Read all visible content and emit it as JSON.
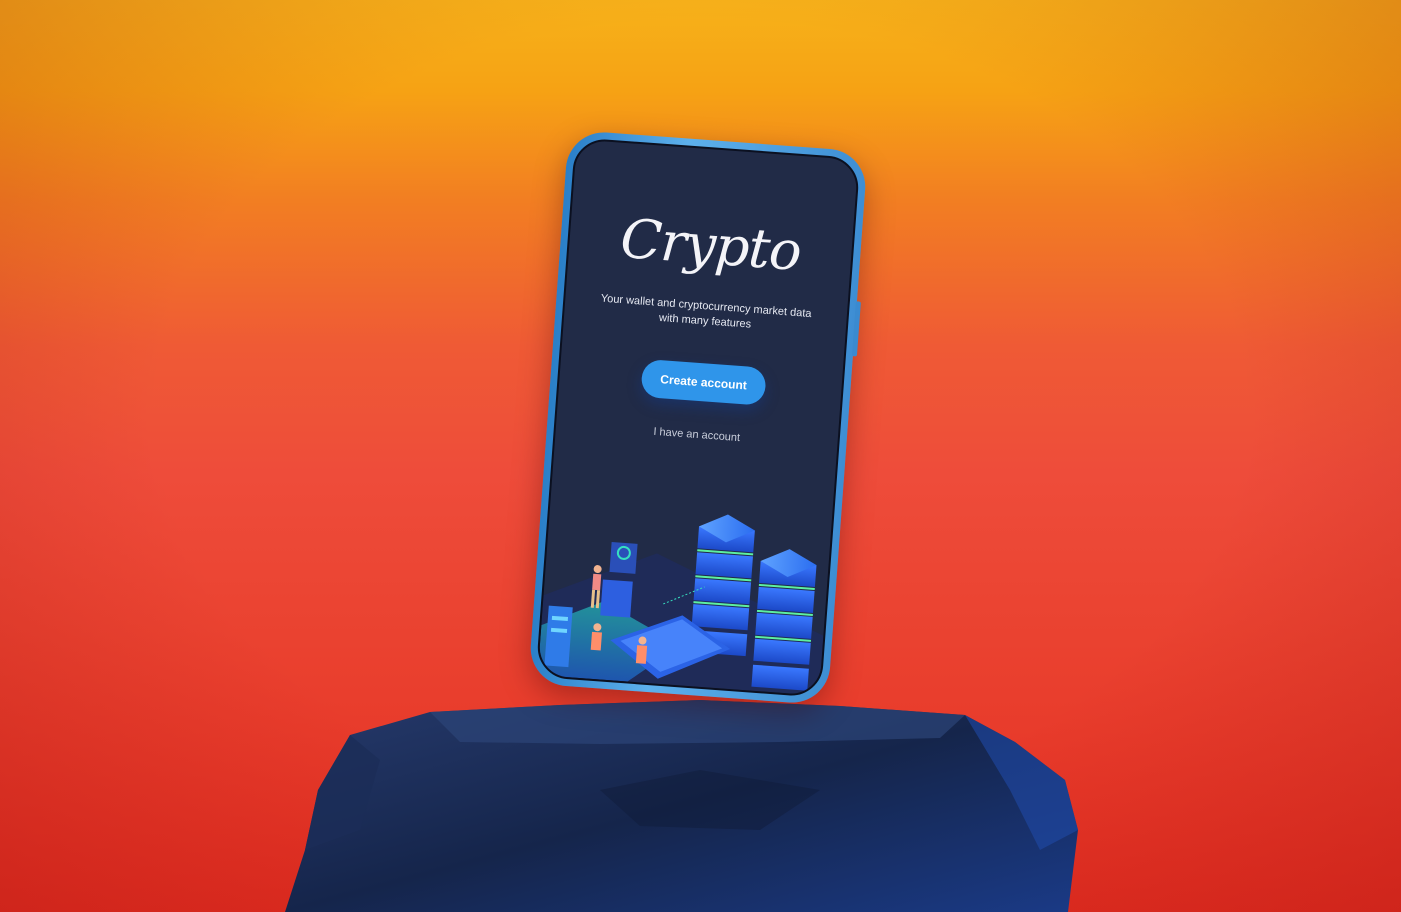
{
  "app": {
    "logo_text": "Crypto",
    "tagline_line1": "Your wallet and cryptocurrency market data",
    "tagline_line2": "with many features",
    "create_account_label": "Create account",
    "login_label": "I have an account"
  },
  "colors": {
    "screen_bg": "#212b47",
    "accent_button": "#2f95ea",
    "phone_frame": "#4aa2e2",
    "rock": "#16254a"
  },
  "illustration": {
    "subject": "isometric data-center servers with people"
  }
}
